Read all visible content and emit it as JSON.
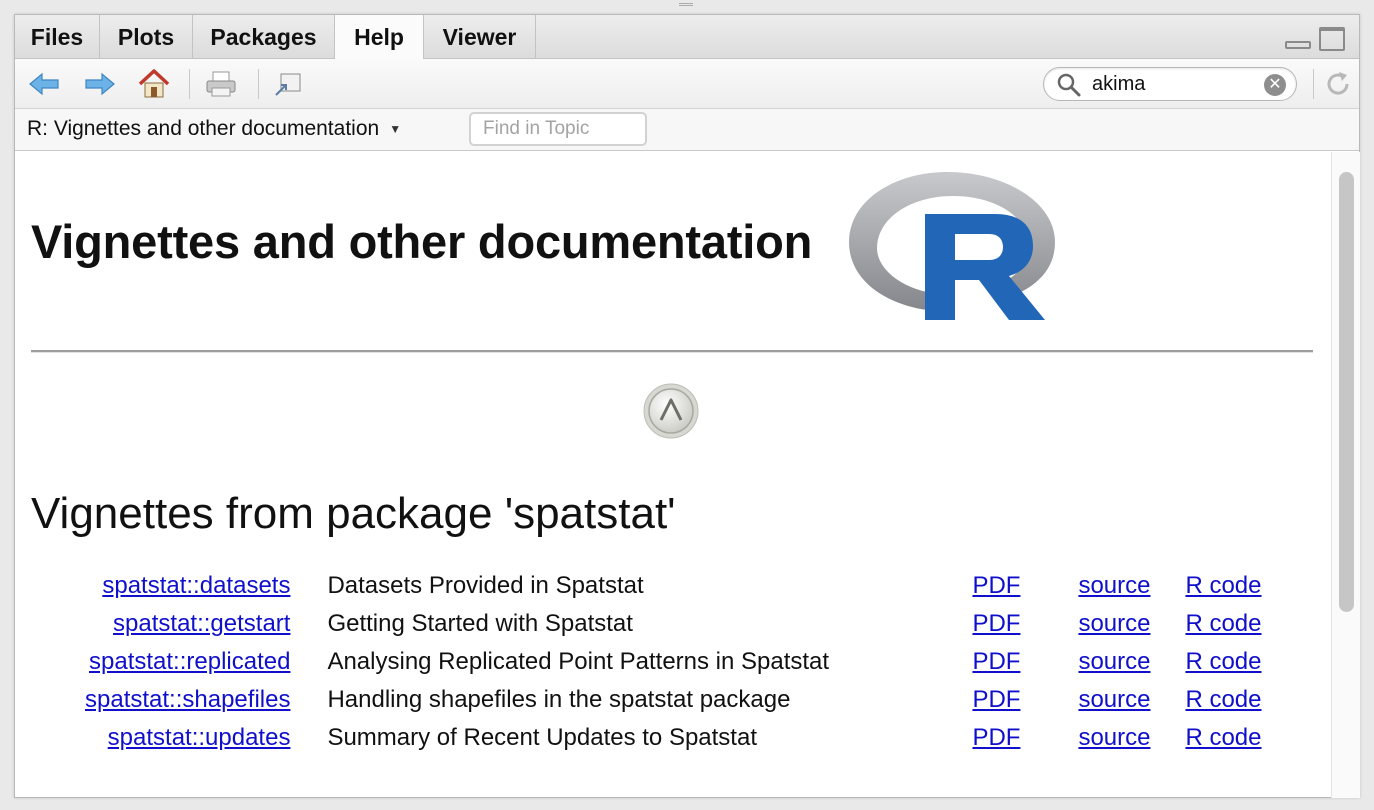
{
  "tabs": [
    {
      "label": "Files",
      "active": false
    },
    {
      "label": "Plots",
      "active": false
    },
    {
      "label": "Packages",
      "active": false
    },
    {
      "label": "Help",
      "active": true
    },
    {
      "label": "Viewer",
      "active": false
    }
  ],
  "toolbar": {
    "icons": [
      "back-arrow-icon",
      "forward-arrow-icon",
      "home-icon",
      "print-icon",
      "popout-icon",
      "refresh-icon"
    ],
    "search": {
      "value": "akima"
    }
  },
  "topic": {
    "selector_label": "R: Vignettes and other documentation",
    "find_placeholder": "Find in Topic"
  },
  "page": {
    "title": "Vignettes and other documentation",
    "section_title": "Vignettes from package 'spatstat'",
    "vignettes": [
      {
        "name": "spatstat::datasets",
        "description": "Datasets Provided in Spatstat",
        "pdf": "PDF",
        "source": "source",
        "rcode": "R code"
      },
      {
        "name": "spatstat::getstart",
        "description": "Getting Started with Spatstat",
        "pdf": "PDF",
        "source": "source",
        "rcode": "R code"
      },
      {
        "name": "spatstat::replicated",
        "description": "Analysing Replicated Point Patterns in Spatstat",
        "pdf": "PDF",
        "source": "source",
        "rcode": "R code"
      },
      {
        "name": "spatstat::shapefiles",
        "description": "Handling shapefiles in the spatstat package",
        "pdf": "PDF",
        "source": "source",
        "rcode": "R code"
      },
      {
        "name": "spatstat::updates",
        "description": "Summary of Recent Updates to Spatstat",
        "pdf": "PDF",
        "source": "source",
        "rcode": "R code"
      }
    ]
  },
  "colors": {
    "link": "#0f0fcc",
    "r_logo_blue": "#2266b8",
    "arrow_blue": "#5aa6de",
    "home_red": "#c0392b"
  }
}
